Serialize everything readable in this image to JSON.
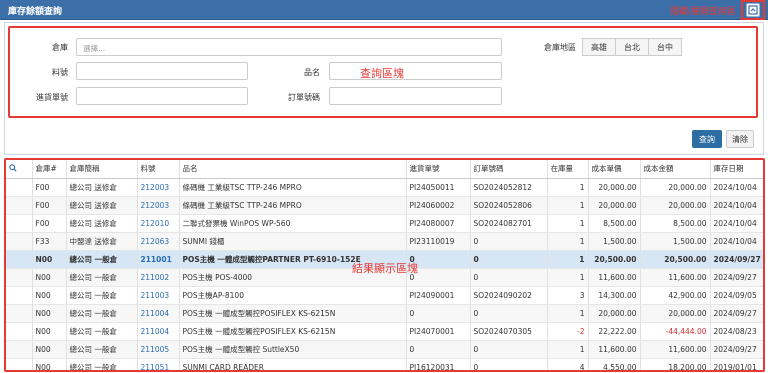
{
  "window": {
    "title": "庫存餘額查詢",
    "toggle_note": "隱藏/展開查詢區"
  },
  "query": {
    "zone_note": "查詢區塊",
    "warehouse_label": "倉庫",
    "warehouse_placeholder": "選擇...",
    "item_no_label": "料號",
    "item_name_label": "品名",
    "receipt_label": "進貨單號",
    "order_label": "訂單號碼",
    "region_label": "倉庫地區",
    "regions": [
      "高雄",
      "台北",
      "台中"
    ],
    "query_button": "查詢",
    "clear_button": "清除"
  },
  "results": {
    "zone_note": "結果顯示區塊",
    "columns": [
      "倉庫#",
      "倉庫簡稱",
      "料號",
      "品名",
      "進貨單號",
      "訂單號碼",
      "在庫量",
      "成本單價",
      "成本金額",
      "庫存日期"
    ],
    "rows": [
      {
        "wh": "F00",
        "wh_name": "總公司 送修倉",
        "item": "212003",
        "name": "條碼機 工業級TSC TTP-246 MPRO",
        "receipt": "PI24050011",
        "order": "SO2024052812",
        "qty": "1",
        "cost": "20,000.00",
        "amount": "20,000.00",
        "date": "2024/10/04"
      },
      {
        "wh": "F00",
        "wh_name": "總公司 送修倉",
        "item": "212003",
        "name": "條碼機 工業級TSC TTP-246 MPRO",
        "receipt": "PI24060002",
        "order": "SO2024052806",
        "qty": "1",
        "cost": "20,000.00",
        "amount": "20,000.00",
        "date": "2024/10/04"
      },
      {
        "wh": "F00",
        "wh_name": "總公司 送修倉",
        "item": "212010",
        "name": "二聯式發票機 WinPOS WP-560",
        "receipt": "PI24080007",
        "order": "SO2024082701",
        "qty": "1",
        "cost": "8,500.00",
        "amount": "8,500.00",
        "date": "2024/10/04"
      },
      {
        "wh": "F33",
        "wh_name": "中盟達 送修倉",
        "item": "212063",
        "name": "SUNMI 錢櫃",
        "receipt": "PI23110019",
        "order": "0",
        "qty": "1",
        "cost": "1,500.00",
        "amount": "1,500.00",
        "date": "2024/10/04"
      },
      {
        "wh": "N00",
        "wh_name": "總公司 一般倉",
        "item": "211001",
        "name": "POS主機 一體成型觸控PARTNER PT-6910-152E",
        "receipt": "0",
        "order": "0",
        "qty": "1",
        "cost": "20,500.00",
        "amount": "20,500.00",
        "date": "2024/09/27"
      },
      {
        "wh": "N00",
        "wh_name": "總公司 一般倉",
        "item": "211002",
        "name": "POS主機 POS-4000",
        "receipt": "0",
        "order": "0",
        "qty": "1",
        "cost": "11,600.00",
        "amount": "11,600.00",
        "date": "2024/09/27"
      },
      {
        "wh": "N00",
        "wh_name": "總公司 一般倉",
        "item": "211003",
        "name": "POS主機AP-8100",
        "receipt": "PI24090001",
        "order": "SO2024090202",
        "qty": "3",
        "cost": "14,300.00",
        "amount": "42,900.00",
        "date": "2024/09/05"
      },
      {
        "wh": "N00",
        "wh_name": "總公司 一般倉",
        "item": "211004",
        "name": "POS主機 一體成型觸控POSIFLEX KS-6215N",
        "receipt": "0",
        "order": "0",
        "qty": "1",
        "cost": "20,000.00",
        "amount": "20,000.00",
        "date": "2024/09/27"
      },
      {
        "wh": "N00",
        "wh_name": "總公司 一般倉",
        "item": "211004",
        "name": "POS主機 一體成型觸控POSIFLEX KS-6215N",
        "receipt": "PI24070001",
        "order": "SO2024070305",
        "qty": "-2",
        "cost": "22,222.00",
        "amount": "-44,444.00",
        "date": "2024/08/23"
      },
      {
        "wh": "N00",
        "wh_name": "總公司 一般倉",
        "item": "211005",
        "name": "POS主機 一體成型觸控 SuttleX50",
        "receipt": "0",
        "order": "0",
        "qty": "1",
        "cost": "11,600.00",
        "amount": "11,600.00",
        "date": "2024/09/27"
      },
      {
        "wh": "N00",
        "wh_name": "總公司 一般倉",
        "item": "211051",
        "name": "SUNMI CARD READER",
        "receipt": "PI16120031",
        "order": "0",
        "qty": "4",
        "cost": "4,550.00",
        "amount": "18,200.00",
        "date": "2019/01/01"
      }
    ]
  }
}
